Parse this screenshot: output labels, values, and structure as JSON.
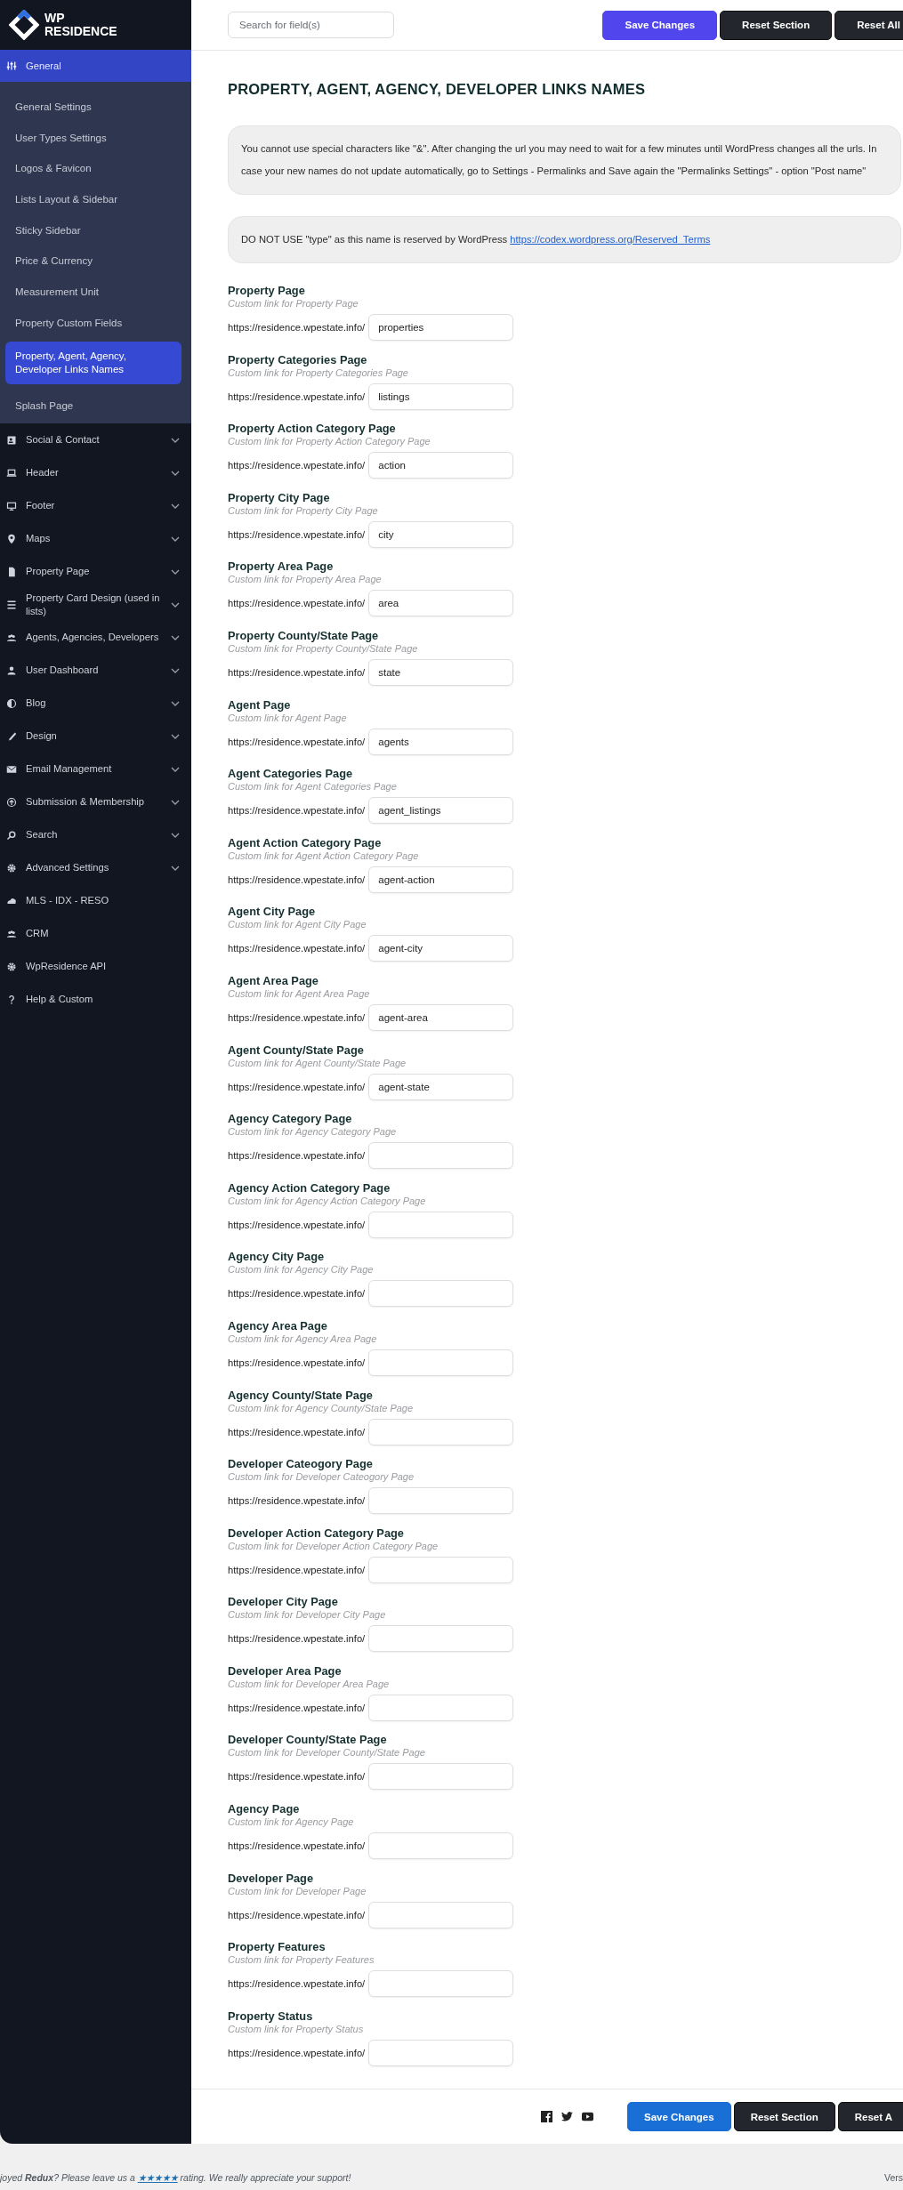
{
  "brand": {
    "line1": "WP",
    "line2": "RESIDENCE"
  },
  "sidebar": {
    "items": [
      {
        "label": "General",
        "kind": "group",
        "selected": true,
        "expanded": true,
        "children": [
          {
            "label": "General Settings",
            "selected": false
          },
          {
            "label": "User Types Settings",
            "selected": false
          },
          {
            "label": "Logos & Favicon",
            "selected": false
          },
          {
            "label": "Lists Layout & Sidebar",
            "selected": false
          },
          {
            "label": "Sticky Sidebar",
            "selected": false
          },
          {
            "label": "Price & Currency",
            "selected": false
          },
          {
            "label": "Measurement Unit",
            "selected": false
          },
          {
            "label": "Property Custom Fields",
            "selected": false
          },
          {
            "label": "Property, Agent, Agency, Developer Links Names",
            "selected": true
          },
          {
            "label": "Splash Page",
            "selected": false
          }
        ]
      },
      {
        "label": "Social & Contact",
        "kind": "group",
        "selected": false,
        "expanded": false
      },
      {
        "label": "Header",
        "kind": "group",
        "selected": false,
        "expanded": false
      },
      {
        "label": "Footer",
        "kind": "group",
        "selected": false,
        "expanded": false
      },
      {
        "label": "Maps",
        "kind": "group",
        "selected": false,
        "expanded": false
      },
      {
        "label": "Property Page",
        "kind": "group",
        "selected": false,
        "expanded": false
      },
      {
        "label": "Property Card Design (used in lists)",
        "kind": "group",
        "selected": false,
        "expanded": false
      },
      {
        "label": "Agents, Agencies, Developers",
        "kind": "group",
        "selected": false,
        "expanded": false
      },
      {
        "label": "User Dashboard",
        "kind": "group",
        "selected": false,
        "expanded": false
      },
      {
        "label": "Blog",
        "kind": "group",
        "selected": false,
        "expanded": false
      },
      {
        "label": "Design",
        "kind": "group",
        "selected": false,
        "expanded": false
      },
      {
        "label": "Email Management",
        "kind": "group",
        "selected": false,
        "expanded": false
      },
      {
        "label": "Submission & Membership",
        "kind": "group",
        "selected": false,
        "expanded": false
      },
      {
        "label": "Search",
        "kind": "group",
        "selected": false,
        "expanded": false
      },
      {
        "label": "Advanced Settings",
        "kind": "group",
        "selected": false,
        "expanded": false
      },
      {
        "label": "MLS - IDX - RESO",
        "kind": "link",
        "selected": false
      },
      {
        "label": "CRM",
        "kind": "link",
        "selected": false
      },
      {
        "label": "WpResidence API",
        "kind": "link",
        "selected": false
      },
      {
        "label": "Help & Custom",
        "kind": "link",
        "selected": false
      }
    ]
  },
  "search": {
    "placeholder": "Search for field(s)"
  },
  "top_buttons": [
    {
      "label": "Save Changes",
      "kind": "primary"
    },
    {
      "label": "Reset Section",
      "kind": "dark"
    },
    {
      "label": "Reset All",
      "kind": "dark"
    }
  ],
  "title": "PROPERTY, AGENT, AGENCY, DEVELOPER LINKS NAMES",
  "notices": [
    {
      "text": "You cannot use special characters like \"&\". After changing the url you may need to wait for a few minutes until WordPress changes all the urls. In case your new names do not update automatically, go to Settings - Permalinks and Save again the \"Permalinks Settings\" - option \"Post name\""
    },
    {
      "text": "DO NOT USE \"type\" as this name is reserved by WordPress",
      "link": "https://codex.wordpress.org/Reserved_Terms"
    }
  ],
  "fields": [
    {
      "label": "Property Page",
      "hint": "Custom link for Property Page",
      "prefix": "https://residence.wpestate.info/",
      "value": "properties"
    },
    {
      "label": "Property Categories Page",
      "hint": "Custom link for Property Categories Page",
      "prefix": "https://residence.wpestate.info/",
      "value": "listings"
    },
    {
      "label": "Property Action Category Page",
      "hint": "Custom link for Property Action Category Page",
      "prefix": "https://residence.wpestate.info/",
      "value": "action"
    },
    {
      "label": "Property City Page",
      "hint": "Custom link for Property City Page",
      "prefix": "https://residence.wpestate.info/",
      "value": "city"
    },
    {
      "label": "Property Area Page",
      "hint": "Custom link for Property Area Page",
      "prefix": "https://residence.wpestate.info/",
      "value": "area"
    },
    {
      "label": "Property County/State Page",
      "hint": "Custom link for Property County/State Page",
      "prefix": "https://residence.wpestate.info/",
      "value": "state"
    },
    {
      "label": "Agent Page",
      "hint": "Custom link for Agent Page",
      "prefix": "https://residence.wpestate.info/",
      "value": "agents"
    },
    {
      "label": "Agent Categories Page",
      "hint": "Custom link for Agent Categories Page",
      "prefix": "https://residence.wpestate.info/",
      "value": "agent_listings"
    },
    {
      "label": "Agent Action Category Page",
      "hint": "Custom link for Agent Action Category Page",
      "prefix": "https://residence.wpestate.info/",
      "value": "agent-action"
    },
    {
      "label": "Agent City Page",
      "hint": "Custom link for Agent City Page",
      "prefix": "https://residence.wpestate.info/",
      "value": "agent-city"
    },
    {
      "label": "Agent Area Page",
      "hint": "Custom link for Agent Area Page",
      "prefix": "https://residence.wpestate.info/",
      "value": "agent-area"
    },
    {
      "label": "Agent County/State Page",
      "hint": "Custom link for Agent County/State Page",
      "prefix": "https://residence.wpestate.info/",
      "value": "agent-state"
    },
    {
      "label": "Agency Category Page",
      "hint": "Custom link for Agency Category Page",
      "prefix": "https://residence.wpestate.info/"
    },
    {
      "label": "Agency Action Category Page",
      "hint": "Custom link for Agency Action Category Page",
      "prefix": "https://residence.wpestate.info/"
    },
    {
      "label": "Agency City Page",
      "hint": "Custom link for Agency City Page",
      "prefix": "https://residence.wpestate.info/"
    },
    {
      "label": "Agency Area Page",
      "hint": "Custom link for Agency Area Page",
      "prefix": "https://residence.wpestate.info/"
    },
    {
      "label": "Agency County/State Page",
      "hint": "Custom link for Agency County/State Page",
      "prefix": "https://residence.wpestate.info/"
    },
    {
      "label": "Developer Cateogory Page",
      "hint": "Custom link for Developer Cateogory Page",
      "prefix": "https://residence.wpestate.info/"
    },
    {
      "label": "Developer Action Category Page",
      "hint": "Custom link for Developer Action Category Page",
      "prefix": "https://residence.wpestate.info/"
    },
    {
      "label": "Developer City Page",
      "hint": "Custom link for Developer City Page",
      "prefix": "https://residence.wpestate.info/"
    },
    {
      "label": "Developer Area Page",
      "hint": "Custom link for Developer Area Page",
      "prefix": "https://residence.wpestate.info/"
    },
    {
      "label": "Developer County/State Page",
      "hint": "Custom link for Developer County/State Page",
      "prefix": "https://residence.wpestate.info/"
    },
    {
      "label": "Agency Page",
      "hint": "Custom link for Agency Page",
      "prefix": "https://residence.wpestate.info/"
    },
    {
      "label": "Developer Page",
      "hint": "Custom link for Developer Page",
      "prefix": "https://residence.wpestate.info/"
    },
    {
      "label": "Property Features",
      "hint": "Custom link for Property Features",
      "prefix": "https://residence.wpestate.info/"
    },
    {
      "label": "Property Status",
      "hint": "Custom link for Property Status",
      "prefix": "https://residence.wpestate.info/"
    }
  ],
  "footer_buttons": [
    {
      "label": "Save Changes",
      "kind": "primary"
    },
    {
      "label": "Reset Section",
      "kind": "dark"
    },
    {
      "label": "Reset A",
      "kind": "dark"
    }
  ],
  "footer_note": {
    "before": "joyed **Redux**? Please leave us a",
    "link": "★★★★★",
    "after": "rating. We really appreciate your support!"
  },
  "version": "Vers"
}
